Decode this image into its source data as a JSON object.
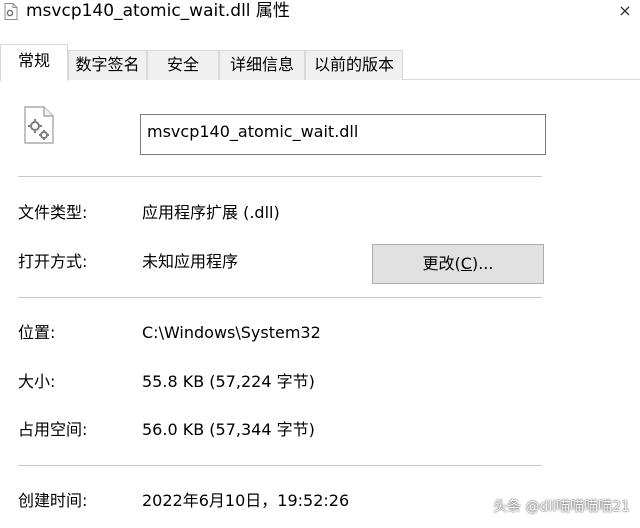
{
  "window": {
    "title": "msvcp140_atomic_wait.dll 属性",
    "title_icon": "gear-file-icon",
    "close_glyph": "×"
  },
  "tabs": [
    {
      "label": "常规",
      "active": true
    },
    {
      "label": "数字签名",
      "active": false
    },
    {
      "label": "安全",
      "active": false
    },
    {
      "label": "详细信息",
      "active": false
    },
    {
      "label": "以前的版本",
      "active": false
    }
  ],
  "general": {
    "file_name": "msvcp140_atomic_wait.dll",
    "file_type_label": "文件类型:",
    "file_type_value": "应用程序扩展 (.dll)",
    "open_with_label": "打开方式:",
    "open_with_value": "未知应用程序",
    "change_button": {
      "prefix": "更改(",
      "accel": "C",
      "suffix": ")..."
    },
    "location_label": "位置:",
    "location_value": "C:\\Windows\\System32",
    "size_label": "大小:",
    "size_value": "55.8 KB (57,224 字节)",
    "size_on_disk_label": "占用空间:",
    "size_on_disk_value": "56.0 KB (57,344 字节)",
    "created_label": "创建时间:",
    "created_value": "2022年6月10日，19:52:26"
  },
  "watermark": "头条 @dll喵喵喵喵21",
  "colors": {
    "tab_inactive_bg": "#f0f0f0",
    "button_bg": "#e1e1e1",
    "border": "#d9d9d9"
  }
}
